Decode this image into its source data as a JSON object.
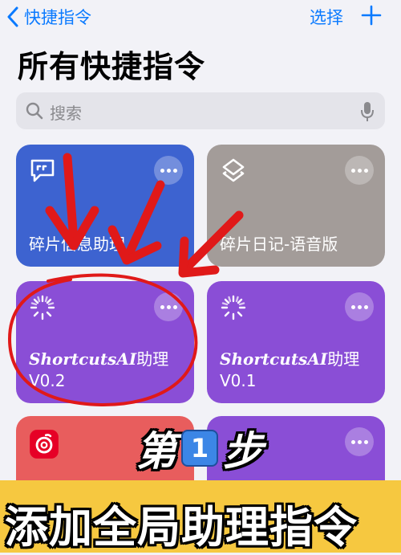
{
  "nav": {
    "back_label": "快捷指令",
    "select_label": "选择"
  },
  "page_title": "所有快捷指令",
  "search": {
    "placeholder": "搜索"
  },
  "shortcuts": [
    {
      "name": "碎片信息助理",
      "color": "#3d63d0",
      "icon": "quote-bubble-icon"
    },
    {
      "name": "碎片日记-语音版",
      "color": "#a39c99",
      "icon": "layers-icon"
    },
    {
      "name_main": "ShortcutsAI",
      "name_suffix": "助理",
      "version": "V0.2",
      "color": "#8a4ed6",
      "icon": "loading-spinner-icon"
    },
    {
      "name_main": "ShortcutsAI",
      "name_suffix": "助理",
      "version": "V0.1",
      "color": "#8a4ed6",
      "icon": "loading-spinner-icon"
    },
    {
      "color": "#e85d5d",
      "icon": "netease-music-icon"
    },
    {
      "color": "#8a4ed6"
    }
  ],
  "annotation": {
    "step_prefix": "第",
    "step_number": "1",
    "step_suffix": "步",
    "banner_text": "添加全局助理指令",
    "arrow_color": "#e01919",
    "banner_color": "#f6c840"
  }
}
